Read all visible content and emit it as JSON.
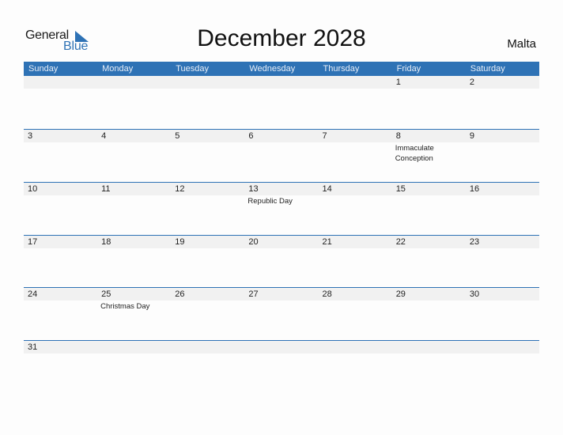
{
  "logo": {
    "general": "General",
    "blue": "Blue",
    "icon": "triangle-flag-icon"
  },
  "title": "December 2028",
  "country": "Malta",
  "colors": {
    "accent": "#2e72b5",
    "date_strip": "#f1f1f1"
  },
  "weekdays": [
    "Sunday",
    "Monday",
    "Tuesday",
    "Wednesday",
    "Thursday",
    "Friday",
    "Saturday"
  ],
  "weeks": [
    {
      "days": [
        {
          "num": "",
          "event": ""
        },
        {
          "num": "",
          "event": ""
        },
        {
          "num": "",
          "event": ""
        },
        {
          "num": "",
          "event": ""
        },
        {
          "num": "",
          "event": ""
        },
        {
          "num": "1",
          "event": ""
        },
        {
          "num": "2",
          "event": ""
        }
      ]
    },
    {
      "days": [
        {
          "num": "3",
          "event": ""
        },
        {
          "num": "4",
          "event": ""
        },
        {
          "num": "5",
          "event": ""
        },
        {
          "num": "6",
          "event": ""
        },
        {
          "num": "7",
          "event": ""
        },
        {
          "num": "8",
          "event": "Immaculate Conception"
        },
        {
          "num": "9",
          "event": ""
        }
      ]
    },
    {
      "days": [
        {
          "num": "10",
          "event": ""
        },
        {
          "num": "11",
          "event": ""
        },
        {
          "num": "12",
          "event": ""
        },
        {
          "num": "13",
          "event": "Republic Day"
        },
        {
          "num": "14",
          "event": ""
        },
        {
          "num": "15",
          "event": ""
        },
        {
          "num": "16",
          "event": ""
        }
      ]
    },
    {
      "days": [
        {
          "num": "17",
          "event": ""
        },
        {
          "num": "18",
          "event": ""
        },
        {
          "num": "19",
          "event": ""
        },
        {
          "num": "20",
          "event": ""
        },
        {
          "num": "21",
          "event": ""
        },
        {
          "num": "22",
          "event": ""
        },
        {
          "num": "23",
          "event": ""
        }
      ]
    },
    {
      "days": [
        {
          "num": "24",
          "event": ""
        },
        {
          "num": "25",
          "event": "Christmas Day"
        },
        {
          "num": "26",
          "event": ""
        },
        {
          "num": "27",
          "event": ""
        },
        {
          "num": "28",
          "event": ""
        },
        {
          "num": "29",
          "event": ""
        },
        {
          "num": "30",
          "event": ""
        }
      ]
    },
    {
      "days": [
        {
          "num": "31",
          "event": ""
        },
        {
          "num": "",
          "event": ""
        },
        {
          "num": "",
          "event": ""
        },
        {
          "num": "",
          "event": ""
        },
        {
          "num": "",
          "event": ""
        },
        {
          "num": "",
          "event": ""
        },
        {
          "num": "",
          "event": ""
        }
      ]
    }
  ]
}
